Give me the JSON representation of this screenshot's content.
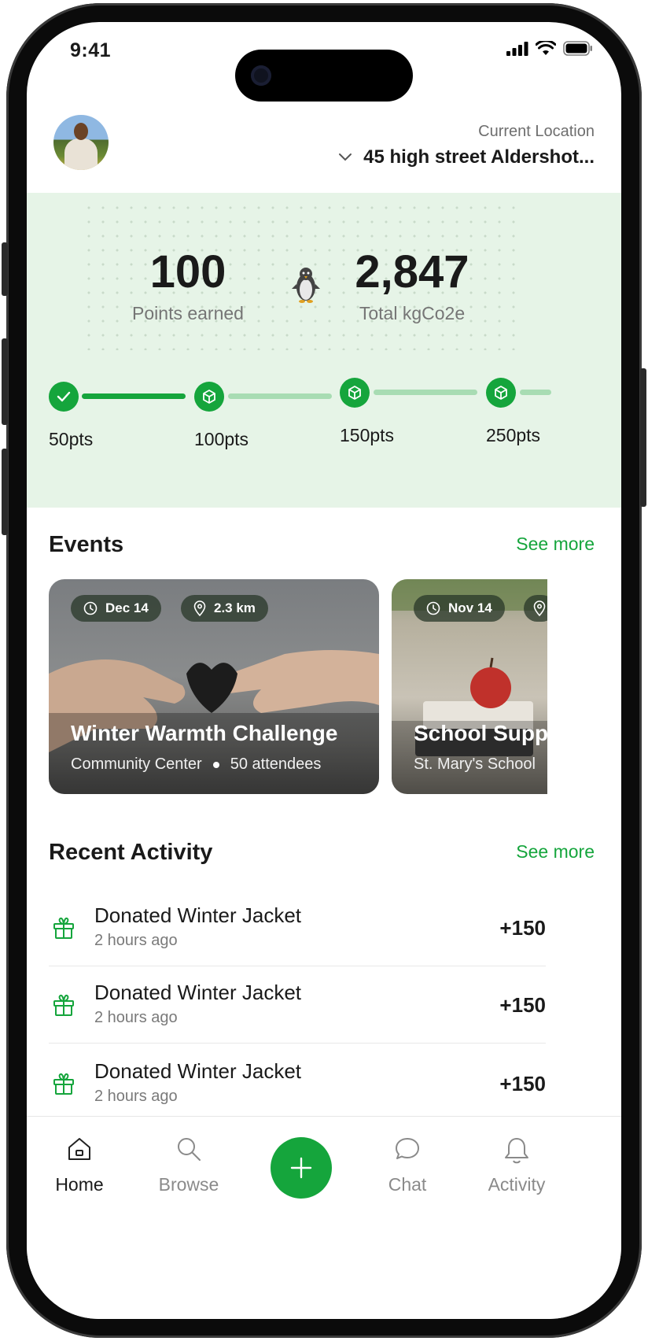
{
  "status_bar": {
    "time": "9:41"
  },
  "header": {
    "location_label": "Current Location",
    "location_value": "45 high street Aldershot..."
  },
  "stats": {
    "points": {
      "value": "100",
      "label": "Points earned"
    },
    "co2": {
      "value": "2,847",
      "label": "Total kgCo2e"
    }
  },
  "milestones": [
    {
      "label": "50pts",
      "state": "completed"
    },
    {
      "label": "100pts",
      "state": "reward"
    },
    {
      "label": "150pts",
      "state": "reward"
    },
    {
      "label": "250pts",
      "state": "reward"
    }
  ],
  "events": {
    "title": "Events",
    "see_more": "See more",
    "cards": [
      {
        "date": "Dec 14",
        "distance": "2.3 km",
        "title": "Winter Warmth Challenge",
        "place": "Community Center",
        "attendees": "50 attendees"
      },
      {
        "date": "Nov 14",
        "distance": "",
        "title": "School Supplies",
        "place": "St. Mary's School",
        "attendees": ""
      }
    ]
  },
  "recent_activity": {
    "title": "Recent Activity",
    "see_more": "See more",
    "items": [
      {
        "title": "Donated Winter Jacket",
        "time": "2 hours ago",
        "points": "+150"
      },
      {
        "title": "Donated Winter Jacket",
        "time": "2 hours ago",
        "points": "+150"
      },
      {
        "title": "Donated Winter Jacket",
        "time": "2 hours ago",
        "points": "+150"
      }
    ]
  },
  "tabbar": {
    "home": "Home",
    "browse": "Browse",
    "chat": "Chat",
    "activity": "Activity"
  },
  "colors": {
    "accent": "#15a53c",
    "panel": "#e6f4e7",
    "track_light": "#a8dcb3"
  }
}
